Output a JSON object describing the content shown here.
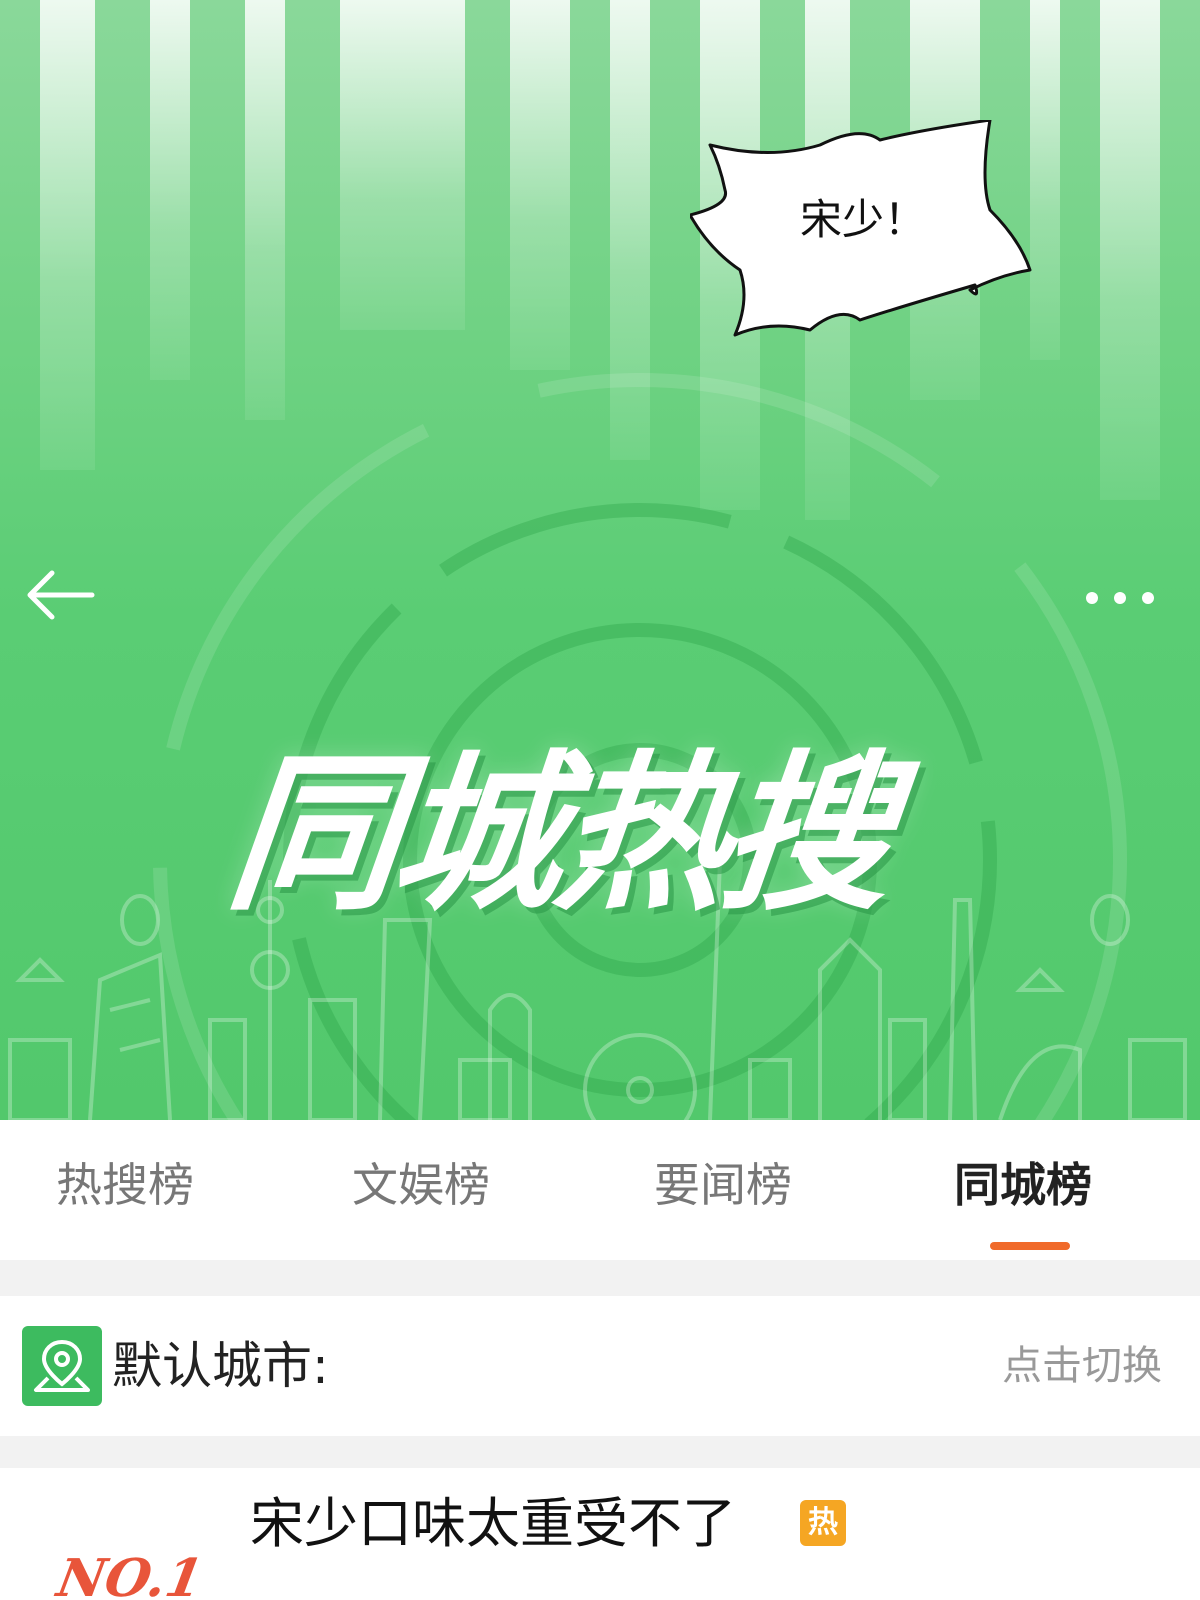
{
  "header": {
    "banner_title": "同城热搜",
    "back_icon": "arrow-left-icon",
    "more_icon": "more-dots-icon"
  },
  "speech_bubble": {
    "text": "宋少！"
  },
  "tabs": [
    {
      "label": "热搜榜",
      "active": false
    },
    {
      "label": "文娱榜",
      "active": false
    },
    {
      "label": "要闻榜",
      "active": false
    },
    {
      "label": "同城榜",
      "active": true
    }
  ],
  "city": {
    "label": "默认城市:",
    "switch_label": "点击切换",
    "icon": "location-pin-icon"
  },
  "list": [
    {
      "rank": "NO.1",
      "title": "宋少口味太重受不了",
      "badge": "热"
    }
  ],
  "colors": {
    "brand_green": "#52c86c",
    "tab_indicator": "#f06a2a",
    "hot_badge": "#f5a623",
    "rank_red": "#e8553a"
  }
}
